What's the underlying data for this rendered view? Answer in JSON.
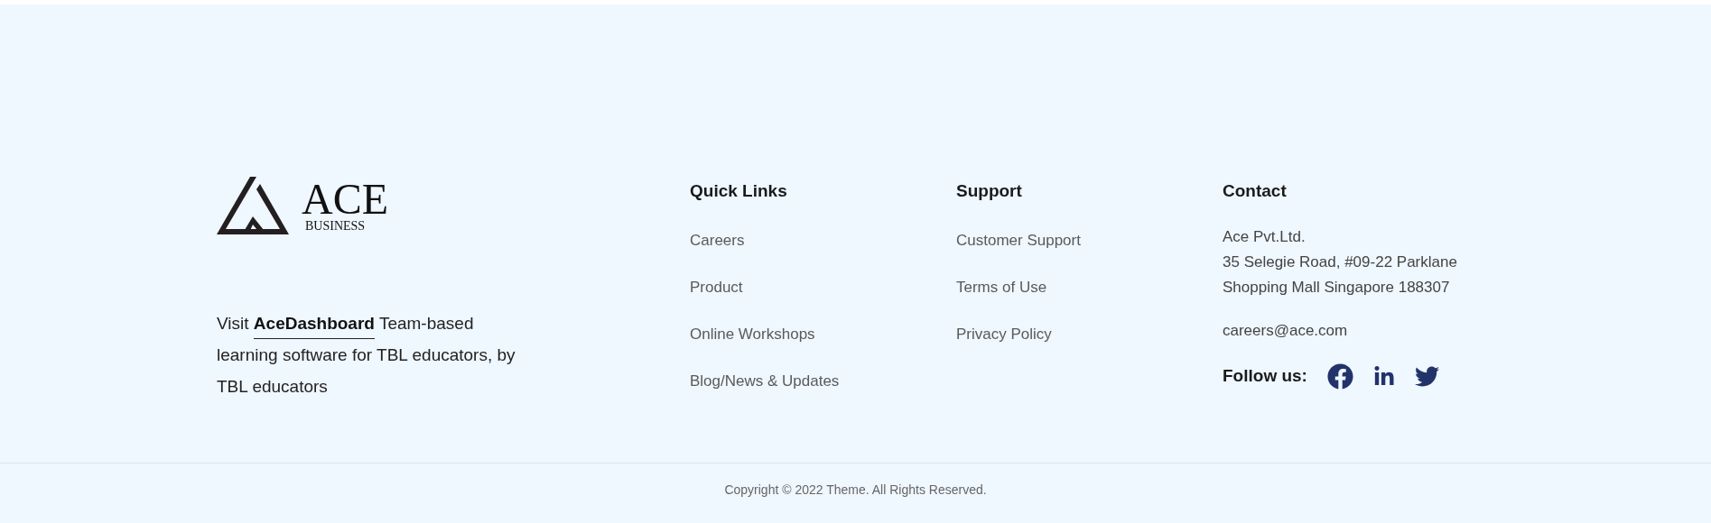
{
  "logo": {
    "name": "ACE",
    "tagline": "BUSINESS"
  },
  "about": {
    "prefix": "Visit",
    "link": "AceDashboard",
    "suffix": "Team-based learning software for TBL educators, by TBL educators"
  },
  "columns": [
    {
      "title": "Quick Links",
      "links": [
        "Careers",
        "Product",
        "Online Workshops",
        "Blog/News & Updates"
      ]
    },
    {
      "title": "Support",
      "links": [
        "Customer Support",
        "Terms of Use",
        "Privacy Policy"
      ]
    }
  ],
  "contact": {
    "title": "Contact",
    "address": [
      "Ace Pvt.Ltd.",
      "35 Selegie Road, #09-22 Parklane",
      "Shopping Mall Singapore 188307"
    ],
    "email": "careers@ace.com",
    "follow_label": "Follow us:",
    "social": [
      {
        "kind": "facebook"
      },
      {
        "kind": "linkedin"
      },
      {
        "kind": "twitter"
      }
    ]
  },
  "copyright": "Copyright © 2022 Theme. All Rights Reserved."
}
